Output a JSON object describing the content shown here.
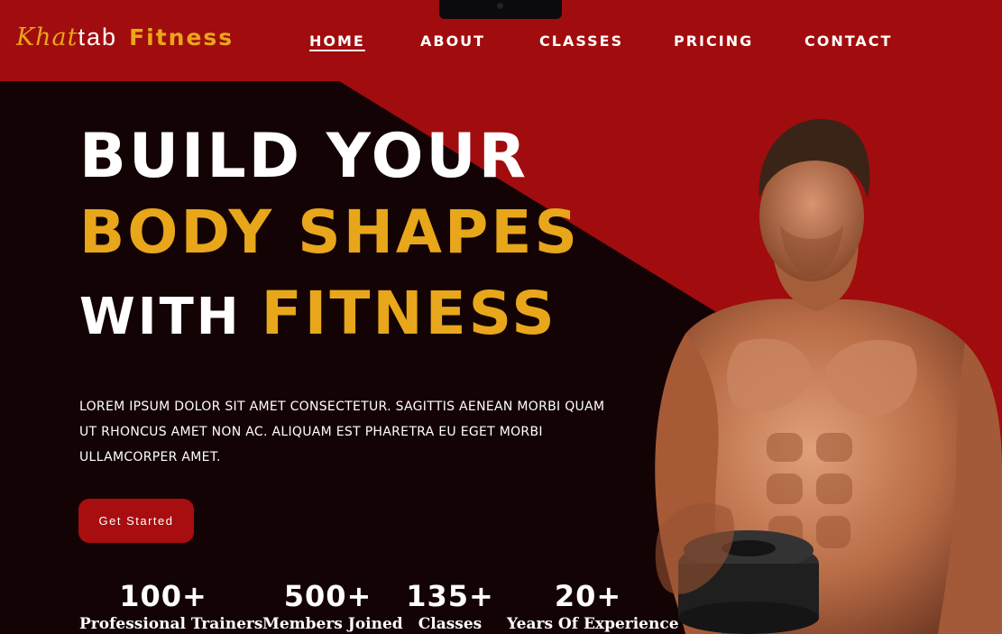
{
  "nav": {
    "logo": {
      "part1": "Khat",
      "part2": "tab",
      "part3": "Fitness"
    },
    "links": [
      {
        "label": "HOME",
        "active": true
      },
      {
        "label": "ABOUT",
        "active": false
      },
      {
        "label": "CLASSES",
        "active": false
      },
      {
        "label": "PRICING",
        "active": false
      },
      {
        "label": "CONTACT",
        "active": false
      }
    ]
  },
  "hero": {
    "line1": "BUILD YOUR",
    "line2": "BODY SHAPES",
    "line3_white": "WITH",
    "line3_accent": "FITNESS",
    "description": "LOREM IPSUM DOLOR SIT AMET CONSECTETUR. SAGITTIS AENEAN MORBI QUAM UT RHONCUS AMET NON AC. ALIQUAM EST PHARETRA EU EGET MORBI ULLAMCORPER AMET.",
    "cta_label": "Get Started",
    "image_icon": "muscular-man-dumbbell-icon"
  },
  "stats": [
    {
      "value": "100+",
      "label": "Professional Trainers"
    },
    {
      "value": "500+",
      "label": "Members Joined"
    },
    {
      "value": "135+",
      "label": "Classes"
    },
    {
      "value": "20+",
      "label": "Years Of Experience"
    }
  ],
  "colors": {
    "accent": "#e8a61b",
    "brand_red": "#a10c0e",
    "dark_bg": "#140304",
    "text": "#ffffff"
  }
}
